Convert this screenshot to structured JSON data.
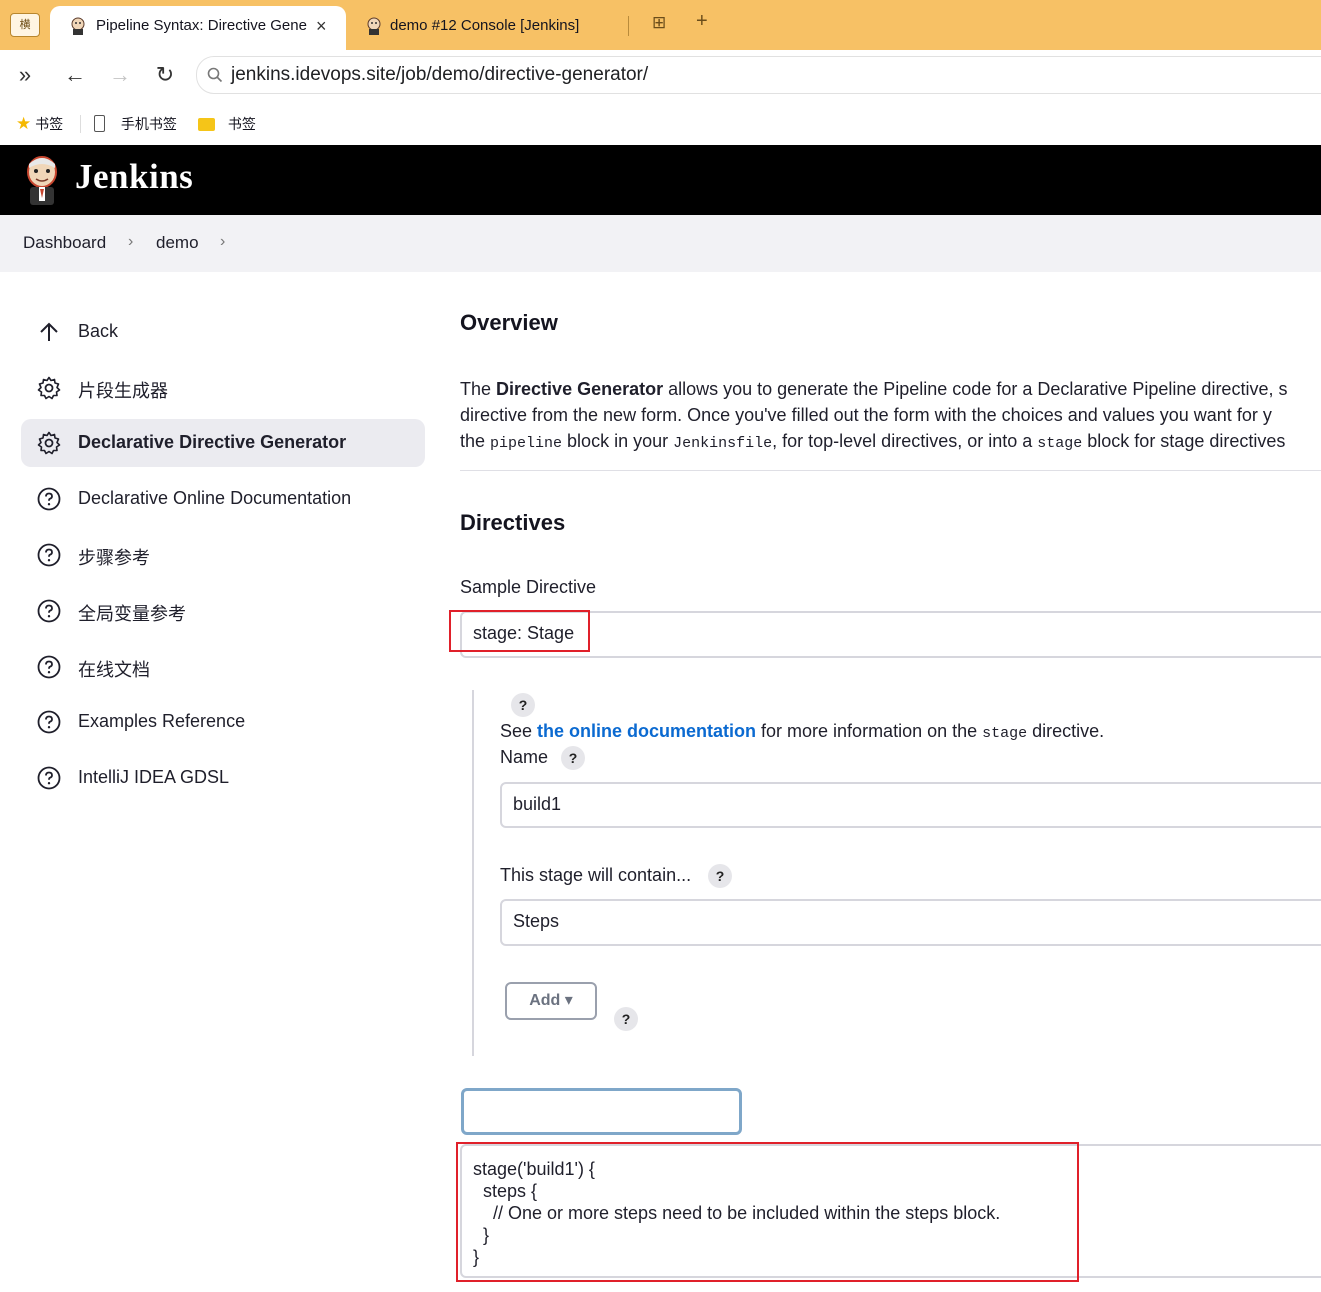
{
  "browser": {
    "tab_group_label": "横",
    "tabs": [
      {
        "title": "Pipeline Syntax: Directive Generator",
        "active": true,
        "close": "×"
      },
      {
        "title": "demo #12 Console [Jenkins]",
        "active": false
      }
    ],
    "new_tab": "+",
    "url": "jenkins.idevops.site/job/demo/directive-generator/",
    "bookmarks": [
      "书签",
      "手机书签",
      "书签"
    ]
  },
  "header": {
    "brand": "Jenkins"
  },
  "breadcrumb": {
    "items": [
      "Dashboard",
      "demo"
    ],
    "separator": "›"
  },
  "sidebar": {
    "items": [
      {
        "label": "Back",
        "icon": "arrow-up-icon"
      },
      {
        "label": "片段生成器",
        "icon": "gear-icon"
      },
      {
        "label": "Declarative Directive Generator",
        "icon": "gear-icon",
        "active": true
      },
      {
        "label": "Declarative Online Documentation",
        "icon": "help-circle-icon"
      },
      {
        "label": "步骤参考",
        "icon": "help-circle-icon"
      },
      {
        "label": "全局变量参考",
        "icon": "help-circle-icon"
      },
      {
        "label": "在线文档",
        "icon": "help-circle-icon"
      },
      {
        "label": "Examples Reference",
        "icon": "help-circle-icon"
      },
      {
        "label": "IntelliJ IDEA GDSL",
        "icon": "help-circle-icon"
      }
    ]
  },
  "overview": {
    "title": "Overview",
    "line1_pre": "The ",
    "line1_bold": "Directive Generator",
    "line1_post": " allows you to generate the Pipeline code for a Declarative Pipeline directive, s",
    "line2": "directive from the new form. Once you've filled out the form with the choices and values you want for y",
    "line3_a": "the ",
    "line3_code1": "pipeline",
    "line3_b": " block in your ",
    "line3_code2": "Jenkinsfile",
    "line3_c": ", for top-level directives, or into a ",
    "line3_code3": "stage",
    "line3_d": " block for stage directives"
  },
  "directives": {
    "title": "Directives",
    "sample_label": "Sample Directive",
    "sample_value": "stage: Stage",
    "help": "?",
    "doc_pre": "See ",
    "doc_link": "the online documentation",
    "doc_mid": " for more information on the ",
    "doc_code": "stage",
    "doc_post": " directive.",
    "name_label": "Name",
    "name_value": "build1",
    "contain_label": "This stage will contain...",
    "contain_value": "Steps",
    "add_label": "Add ▾"
  },
  "output": {
    "generate_label": "",
    "code": "stage('build1') {\n  steps {\n    // One or more steps need to be included within the steps block.\n  }\n}"
  }
}
